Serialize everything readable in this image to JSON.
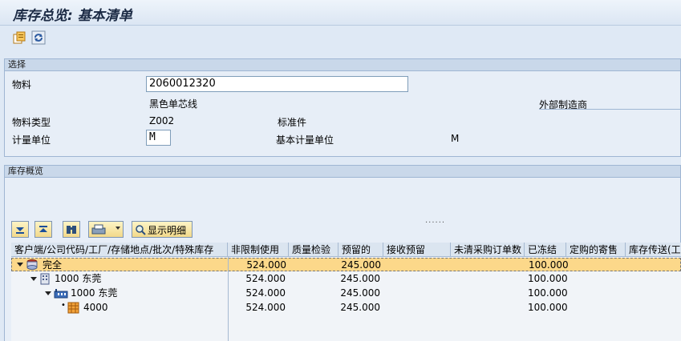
{
  "title": "库存总览: 基本清单",
  "toolbar": {
    "icons": [
      "copy-document-icon",
      "refresh-icon"
    ]
  },
  "selection": {
    "header": "选择",
    "material_label": "物料",
    "material_value": "2060012320",
    "material_desc": "黑色单芯线",
    "external_mfr_label": "外部制造商",
    "material_type_label": "物料类型",
    "material_type_value": "Z002",
    "material_type_desc": "标准件",
    "uom_label": "计量单位",
    "uom_value": "M",
    "base_uom_label": "基本计量单位",
    "base_uom_value": "M"
  },
  "overview": {
    "header": "库存概览",
    "splitter": "......",
    "detail_button": "显示明细"
  },
  "grid": {
    "columns": [
      "客户端/公司代码/工厂/存储地点/批次/特殊库存",
      "非限制使用",
      "质量检验",
      "预留的",
      "接收预留",
      "未清采购订单数",
      "已冻结",
      "定购的寄售",
      "库存传送(工"
    ],
    "rows": [
      {
        "label": "完全",
        "unrestricted": "524.000",
        "reserved": "245.000",
        "blocked": "100.000"
      },
      {
        "label": "1000 东莞",
        "unrestricted": "524.000",
        "reserved": "245.000",
        "blocked": "100.000"
      },
      {
        "label": "1000 东莞",
        "unrestricted": "524.000",
        "reserved": "245.000",
        "blocked": "100.000"
      },
      {
        "label": "4000",
        "unrestricted": "524.000",
        "reserved": "245.000",
        "blocked": "100.000"
      }
    ]
  },
  "colors": {
    "total_row": "#fcd88a",
    "header_bg": "#dbe5f0"
  }
}
